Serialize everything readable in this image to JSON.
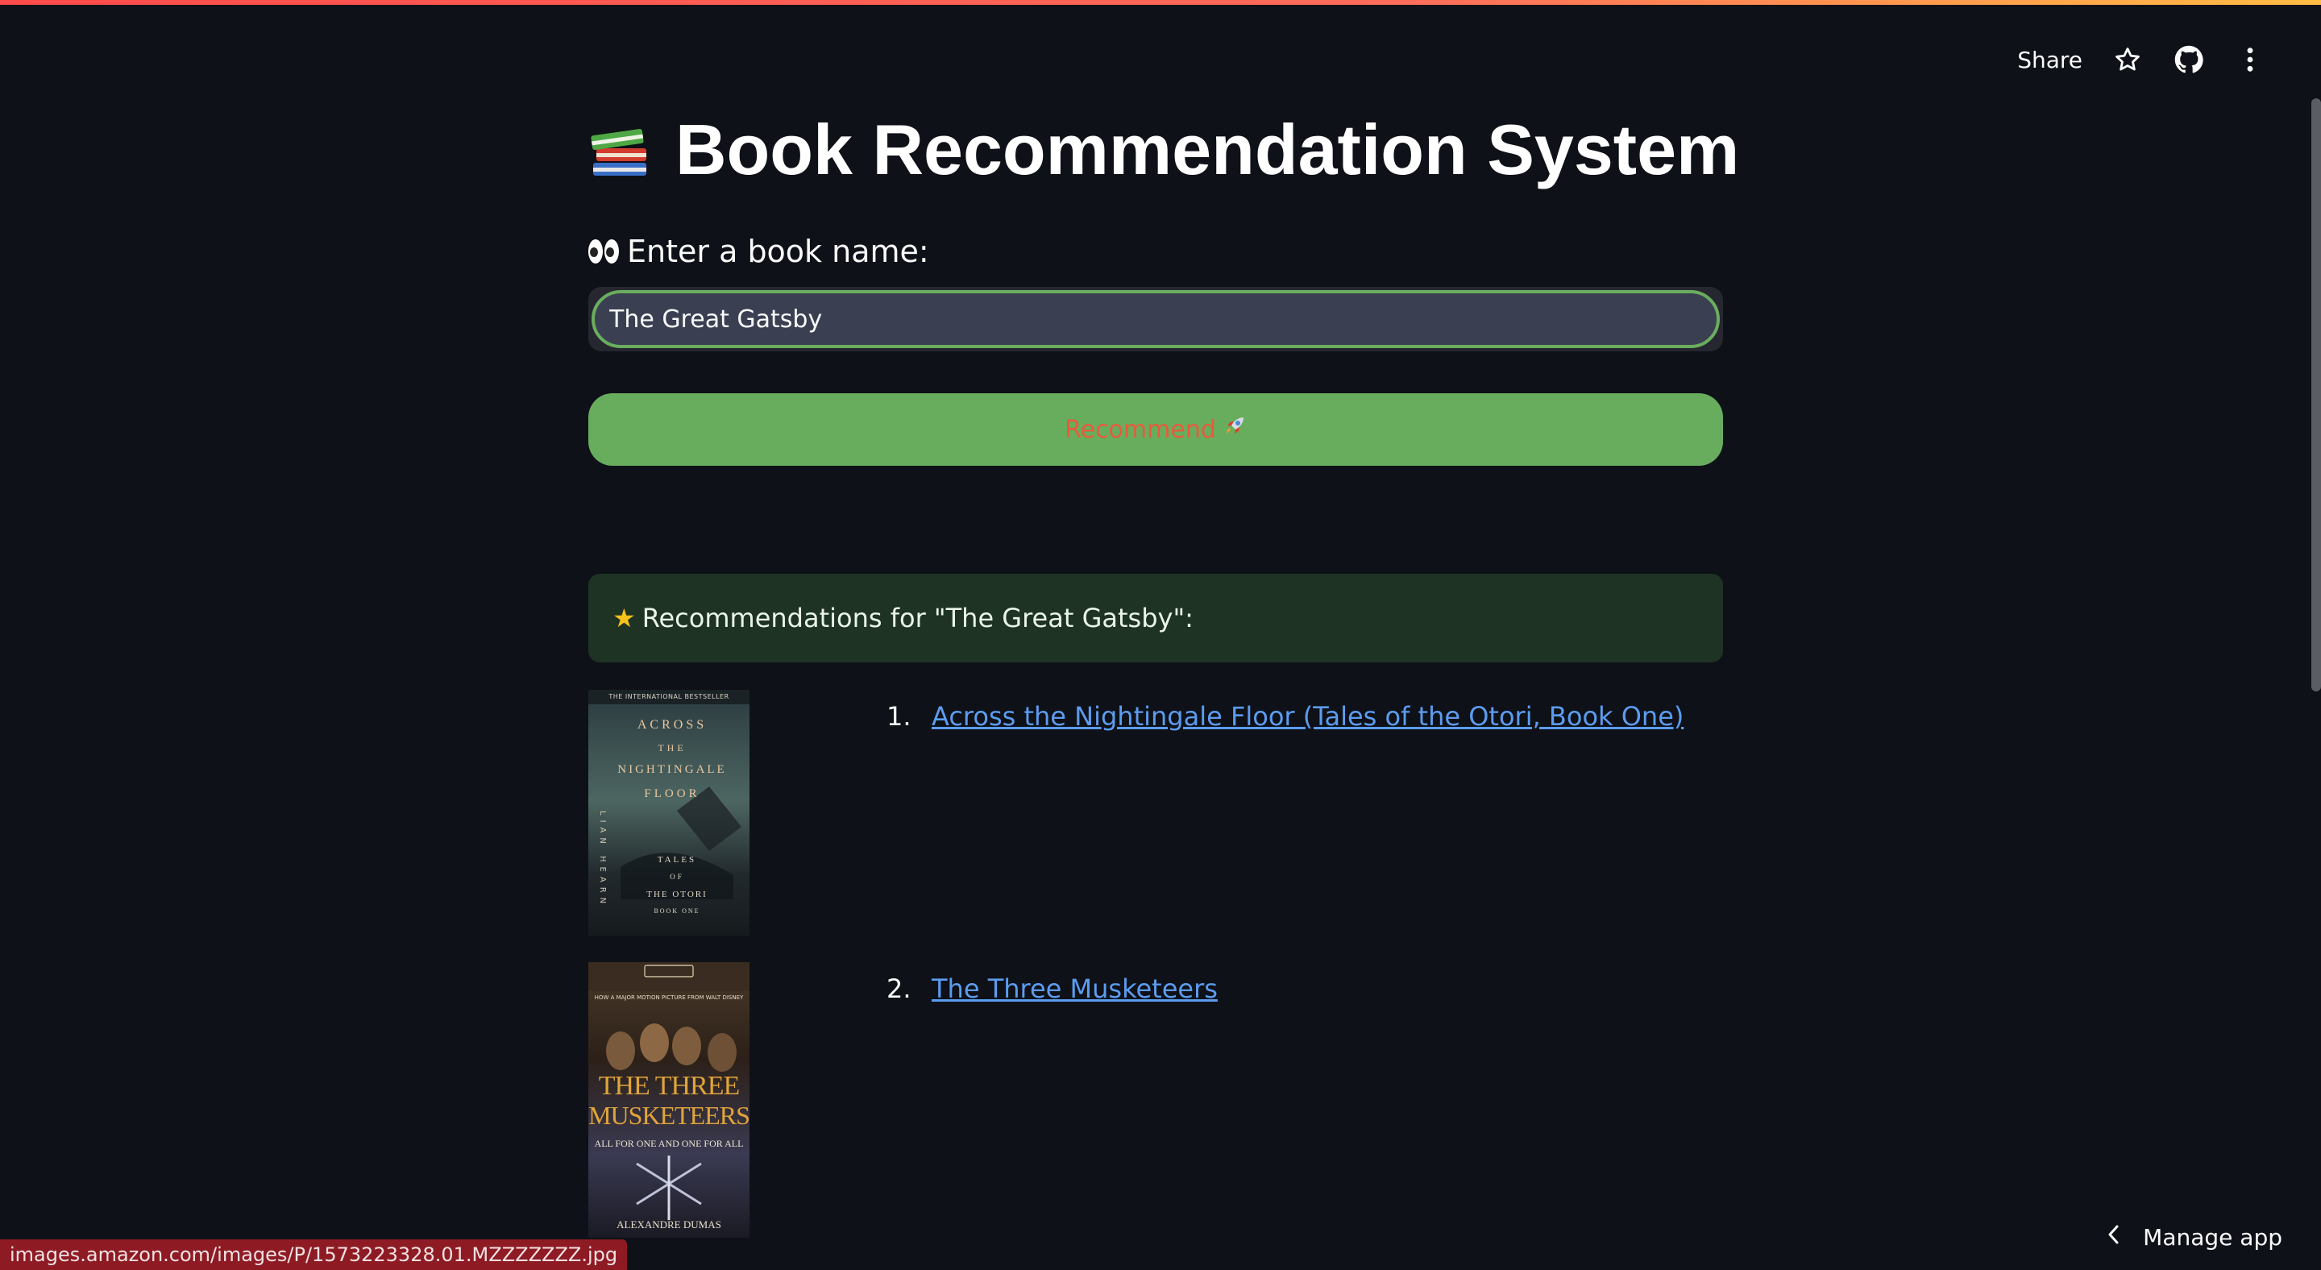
{
  "header": {
    "share_label": "Share",
    "icons": [
      "star-icon",
      "github-icon",
      "kebab-menu-icon"
    ]
  },
  "page": {
    "title": "Book Recommendation System",
    "title_icon": "books-icon"
  },
  "form": {
    "label": "Enter a book name:",
    "label_icon": "eyes-icon",
    "input_value": "The Great Gatsby",
    "button_label": "Recommend",
    "button_icon": "rocket-icon"
  },
  "results": {
    "heading": "Recommendations for \"The Great Gatsby\":",
    "heading_icon": "star-icon",
    "items": [
      {
        "number": "1.",
        "title": "Across the Nightingale Floor (Tales of the Otori, Book One)"
      },
      {
        "number": "2.",
        "title": "The Three Musketeers"
      }
    ]
  },
  "covers": [
    {
      "top_line": "THE INTERNATIONAL BESTSELLER",
      "title_lines": [
        "ACROSS",
        "THE",
        "NIGHTINGALE",
        "FLOOR"
      ],
      "sub_lines": [
        "TALES",
        "OF",
        "THE OTORI"
      ],
      "book_line": "BOOK ONE",
      "author": "LIAN HEARN"
    },
    {
      "top_line": "HOW A MAJOR MOTION PICTURE FROM WALT DISNEY",
      "title_lines": [
        "THE THREE",
        "MUSKETEERS"
      ],
      "tagline": "ALL FOR ONE AND ONE FOR ALL",
      "author": "ALEXANDRE DUMAS"
    }
  ],
  "status_bar": {
    "url": "images.amazon.com/images/P/1573223328.01.MZZZZZZZ.jpg"
  },
  "footer": {
    "manage_label": "Manage app"
  },
  "colors": {
    "background": "#0e1117",
    "accent_green": "#68ad5d",
    "button_text": "#e85b3d",
    "link": "#5c9cf0",
    "success_bg": "#1e3324"
  }
}
